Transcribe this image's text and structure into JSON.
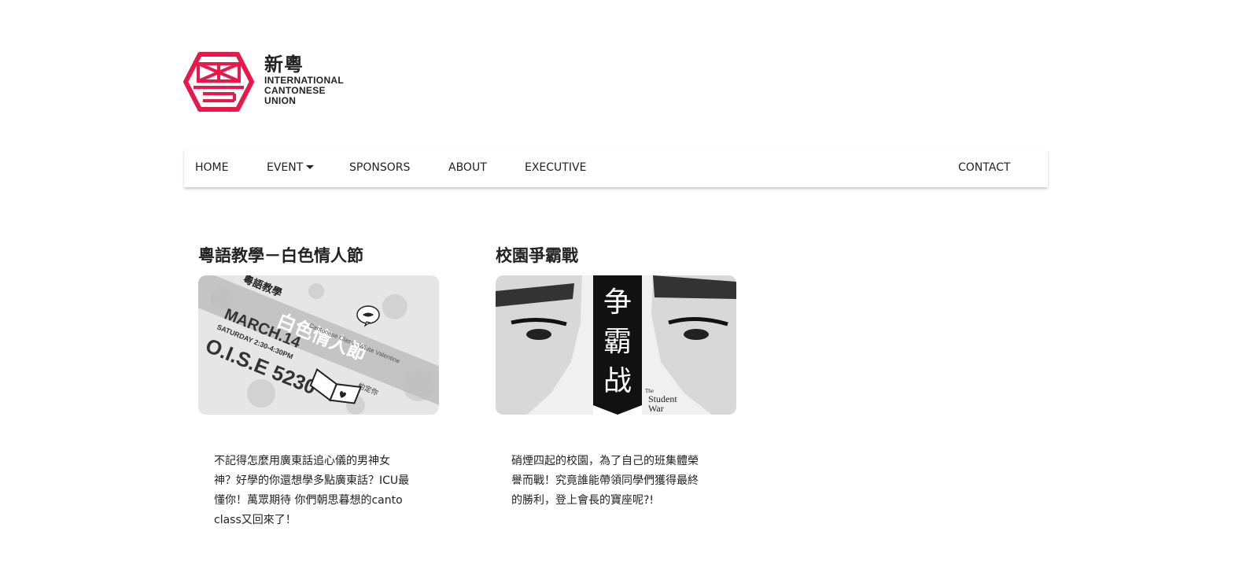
{
  "brand": {
    "name_cn": "新粵",
    "name_en_line1": "INTERNATIONAL",
    "name_en_line2": "CANTONESE",
    "name_en_line3": "UNION",
    "color": "#e8184a"
  },
  "nav": {
    "home": "HOME",
    "event": "EVENT",
    "sponsors": "SPONSORS",
    "about": "ABOUT",
    "executive": "EXECUTIVE",
    "contact": "CONTACT"
  },
  "events": [
    {
      "title": "粵語教學－白色情人節",
      "poster": {
        "heading": "粵語教學",
        "subtitle": "白色情人節",
        "english": "Cantonese Class - White Valentine",
        "date": "MARCH.14",
        "time": "SATURDAY 2:30-4:30PM",
        "venue": "O.I.S.E 5230",
        "note": "約定你"
      },
      "description": "不記得怎麼用廣東話追心儀的男神女神？好學的你還想學多點廣東話？ICU最懂你！萬眾期待 你們朝思暮想的canto class又回來了！"
    },
    {
      "title": "校園爭霸戰",
      "poster": {
        "banner_1": "争",
        "banner_2": "霸",
        "banner_3": "战",
        "english_1": "The",
        "english_2": "Student",
        "english_3": "War"
      },
      "description": "硝煙四起的校園，為了自己的班集體榮譽而戰！究竟誰能帶領同學們獲得最終的勝利，登上會長的寶座呢?!"
    }
  ]
}
